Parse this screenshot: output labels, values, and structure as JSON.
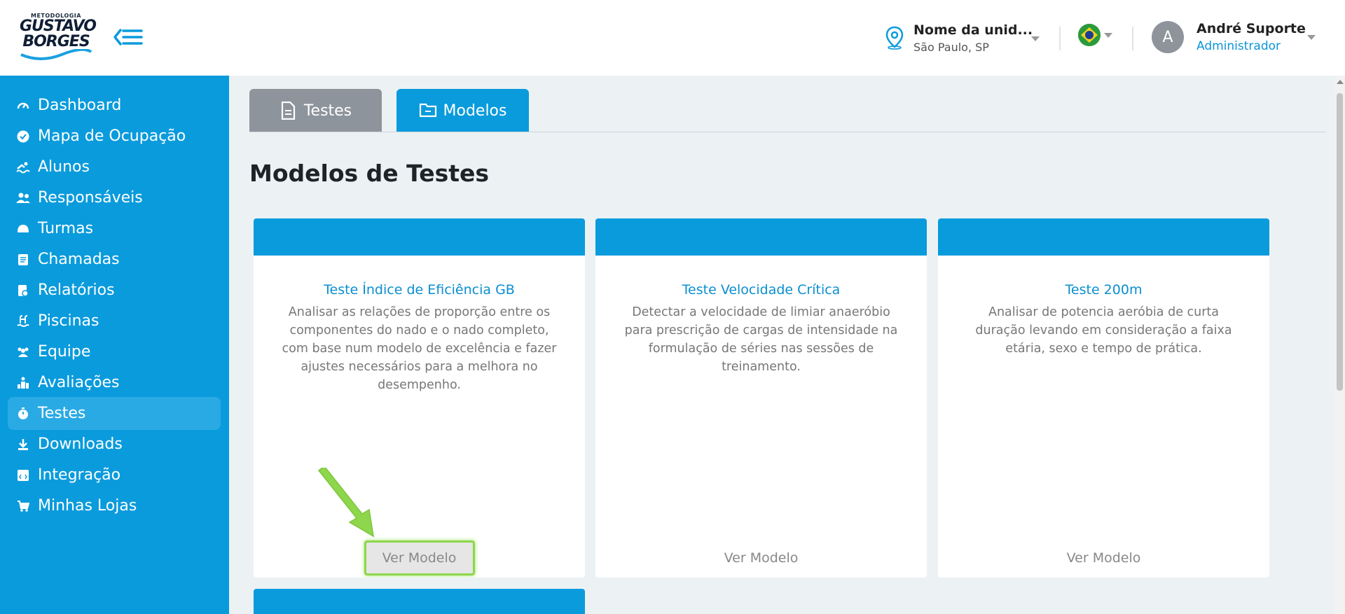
{
  "header": {
    "logo": {
      "tagline": "METODOLOGIA",
      "line1": "GUSTAVO",
      "line2": "BORGES"
    },
    "unit": {
      "name": "Nome da unid...",
      "city": "São Paulo, SP"
    },
    "language": {
      "flag": "brazil-flag-icon"
    },
    "user": {
      "initial": "A",
      "name": "André Suporte",
      "role": "Administrador"
    }
  },
  "sidebar": {
    "items": [
      {
        "label": "Dashboard",
        "icon": "speedometer-icon"
      },
      {
        "label": "Mapa de Ocupação",
        "icon": "check-circle-icon"
      },
      {
        "label": "Alunos",
        "icon": "swimmer-icon"
      },
      {
        "label": "Responsáveis",
        "icon": "users-icon"
      },
      {
        "label": "Turmas",
        "icon": "swim-cap-icon"
      },
      {
        "label": "Chamadas",
        "icon": "clipboard-icon"
      },
      {
        "label": "Relatórios",
        "icon": "report-icon"
      },
      {
        "label": "Piscinas",
        "icon": "pool-ladder-icon"
      },
      {
        "label": "Equipe",
        "icon": "team-icon"
      },
      {
        "label": "Avaliações",
        "icon": "podium-icon"
      },
      {
        "label": "Testes",
        "icon": "stopwatch-icon",
        "active": true
      },
      {
        "label": "Downloads",
        "icon": "download-icon"
      },
      {
        "label": "Integração",
        "icon": "code-window-icon"
      },
      {
        "label": "Minhas Lojas",
        "icon": "cart-icon"
      }
    ]
  },
  "tabs": [
    {
      "label": "Testes",
      "icon": "document-icon"
    },
    {
      "label": "Modelos",
      "icon": "folder-icon",
      "active": true
    }
  ],
  "page": {
    "title": "Modelos de Testes"
  },
  "cards": [
    {
      "title": "Teste Índice de Eficiência GB",
      "description": "Analisar as relações de proporção entre os componentes do nado e o nado completo, com base num modelo de excelência e fazer ajustes necessários para a melhora no desempenho.",
      "button": "Ver Modelo"
    },
    {
      "title": "Teste Velocidade Crítica",
      "description": "Detectar a velocidade de limiar anaeróbio para prescrição de cargas de intensidade na formulação de séries nas sessões de treinamento.",
      "button": "Ver Modelo"
    },
    {
      "title": "Teste 200m",
      "description": "Analisar de potencia aeróbia de curta duração levando em consideração a faixa etária, sexo e tempo de prática.",
      "button": "Ver Modelo"
    }
  ],
  "colors": {
    "primary": "#0a9bdc",
    "tab_inactive": "#8e949c",
    "highlight": "#8ed64b",
    "background": "#ecf2f4"
  }
}
